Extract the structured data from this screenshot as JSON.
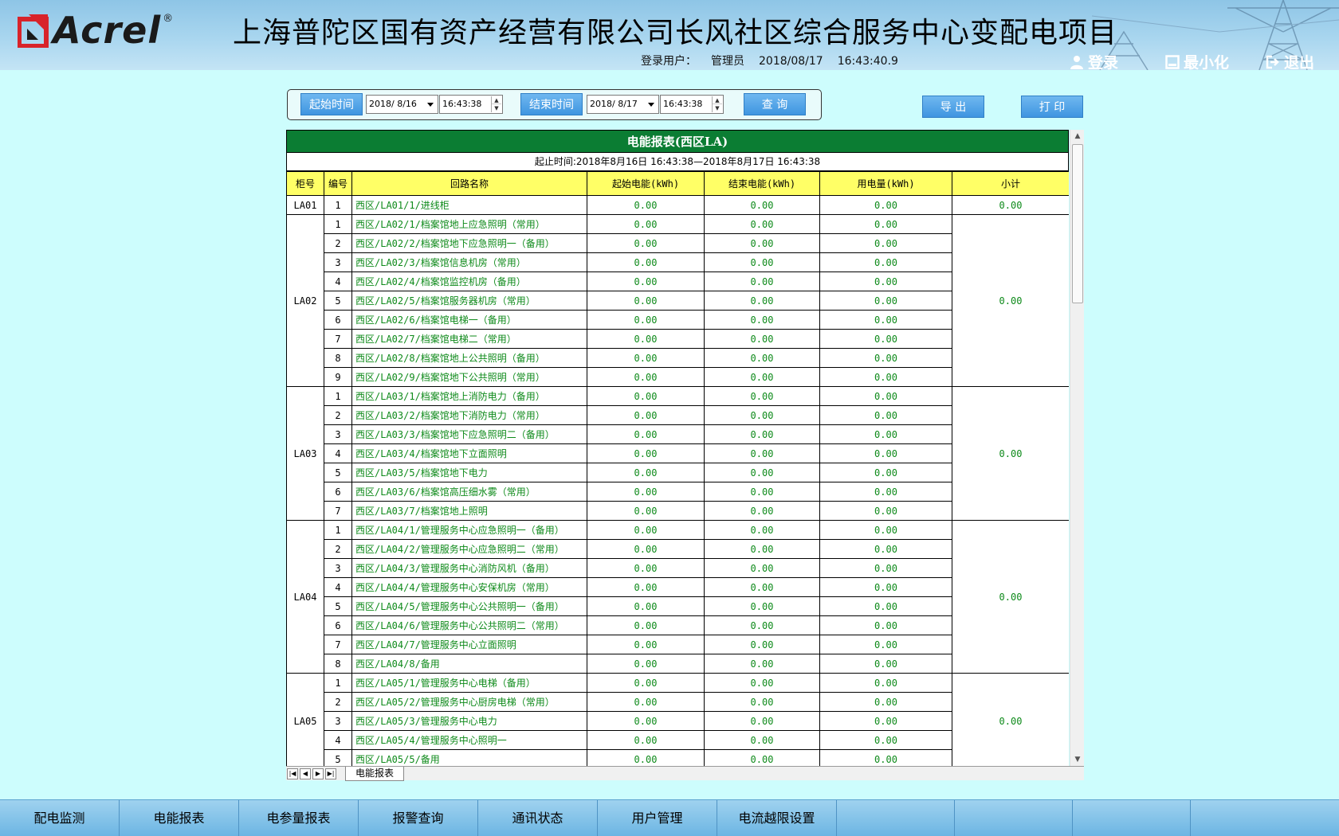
{
  "header": {
    "logo_text": "Acrel",
    "logo_reg": "®",
    "title": "上海普陀区国有资产经营有限公司长风社区综合服务中心变配电项目",
    "login_label": "登录用户：",
    "user": "管理员",
    "date": "2018/08/17",
    "time": "16:43:40.9",
    "buttons": {
      "login": "登录",
      "minimize": "最小化",
      "exit": "退出"
    }
  },
  "query": {
    "start_label": "起始时间",
    "start_date": "2018/ 8/16",
    "start_time": "16:43:38",
    "end_label": "结束时间",
    "end_date": "2018/ 8/17",
    "end_time": "16:43:38",
    "query_button": "查 询",
    "export_button": "导 出",
    "print_button": "打 印"
  },
  "report": {
    "title": "电能报表(西区LA)",
    "time_range": "起止时间:2018年8月16日  16:43:38—2018年8月17日  16:43:38",
    "columns": [
      "柜号",
      "编号",
      "回路名称",
      "起始电能(kWh)",
      "结束电能(kWh)",
      "用电量(kWh)",
      "小计"
    ],
    "groups": [
      {
        "cabinet": "LA01",
        "subtotal": "0.00",
        "rows": [
          {
            "num": "1",
            "name": "西区/LA01/1/进线柜",
            "start": "0.00",
            "end": "0.00",
            "usage": "0.00"
          }
        ]
      },
      {
        "cabinet": "LA02",
        "subtotal": "0.00",
        "rows": [
          {
            "num": "1",
            "name": "西区/LA02/1/档案馆地上应急照明（常用）",
            "start": "0.00",
            "end": "0.00",
            "usage": "0.00"
          },
          {
            "num": "2",
            "name": "西区/LA02/2/档案馆地下应急照明一（备用）",
            "start": "0.00",
            "end": "0.00",
            "usage": "0.00"
          },
          {
            "num": "3",
            "name": "西区/LA02/3/档案馆信息机房（常用）",
            "start": "0.00",
            "end": "0.00",
            "usage": "0.00"
          },
          {
            "num": "4",
            "name": "西区/LA02/4/档案馆监控机房（备用）",
            "start": "0.00",
            "end": "0.00",
            "usage": "0.00"
          },
          {
            "num": "5",
            "name": "西区/LA02/5/档案馆服务器机房（常用）",
            "start": "0.00",
            "end": "0.00",
            "usage": "0.00"
          },
          {
            "num": "6",
            "name": "西区/LA02/6/档案馆电梯一（备用）",
            "start": "0.00",
            "end": "0.00",
            "usage": "0.00"
          },
          {
            "num": "7",
            "name": "西区/LA02/7/档案馆电梯二（常用）",
            "start": "0.00",
            "end": "0.00",
            "usage": "0.00"
          },
          {
            "num": "8",
            "name": "西区/LA02/8/档案馆地上公共照明（备用）",
            "start": "0.00",
            "end": "0.00",
            "usage": "0.00"
          },
          {
            "num": "9",
            "name": "西区/LA02/9/档案馆地下公共照明（常用）",
            "start": "0.00",
            "end": "0.00",
            "usage": "0.00"
          }
        ]
      },
      {
        "cabinet": "LA03",
        "subtotal": "0.00",
        "rows": [
          {
            "num": "1",
            "name": "西区/LA03/1/档案馆地上消防电力（备用）",
            "start": "0.00",
            "end": "0.00",
            "usage": "0.00"
          },
          {
            "num": "2",
            "name": "西区/LA03/2/档案馆地下消防电力（常用）",
            "start": "0.00",
            "end": "0.00",
            "usage": "0.00"
          },
          {
            "num": "3",
            "name": "西区/LA03/3/档案馆地下应急照明二（备用）",
            "start": "0.00",
            "end": "0.00",
            "usage": "0.00"
          },
          {
            "num": "4",
            "name": "西区/LA03/4/档案馆地下立面照明",
            "start": "0.00",
            "end": "0.00",
            "usage": "0.00"
          },
          {
            "num": "5",
            "name": "西区/LA03/5/档案馆地下电力",
            "start": "0.00",
            "end": "0.00",
            "usage": "0.00"
          },
          {
            "num": "6",
            "name": "西区/LA03/6/档案馆高压细水雾（常用）",
            "start": "0.00",
            "end": "0.00",
            "usage": "0.00"
          },
          {
            "num": "7",
            "name": "西区/LA03/7/档案馆地上照明",
            "start": "0.00",
            "end": "0.00",
            "usage": "0.00"
          }
        ]
      },
      {
        "cabinet": "LA04",
        "subtotal": "0.00",
        "rows": [
          {
            "num": "1",
            "name": "西区/LA04/1/管理服务中心应急照明一（备用）",
            "start": "0.00",
            "end": "0.00",
            "usage": "0.00"
          },
          {
            "num": "2",
            "name": "西区/LA04/2/管理服务中心应急照明二（常用）",
            "start": "0.00",
            "end": "0.00",
            "usage": "0.00"
          },
          {
            "num": "3",
            "name": "西区/LA04/3/管理服务中心消防风机（备用）",
            "start": "0.00",
            "end": "0.00",
            "usage": "0.00"
          },
          {
            "num": "4",
            "name": "西区/LA04/4/管理服务中心安保机房（常用）",
            "start": "0.00",
            "end": "0.00",
            "usage": "0.00"
          },
          {
            "num": "5",
            "name": "西区/LA04/5/管理服务中心公共照明一（备用）",
            "start": "0.00",
            "end": "0.00",
            "usage": "0.00"
          },
          {
            "num": "6",
            "name": "西区/LA04/6/管理服务中心公共照明二（常用）",
            "start": "0.00",
            "end": "0.00",
            "usage": "0.00"
          },
          {
            "num": "7",
            "name": "西区/LA04/7/管理服务中心立面照明",
            "start": "0.00",
            "end": "0.00",
            "usage": "0.00"
          },
          {
            "num": "8",
            "name": "西区/LA04/8/备用",
            "start": "0.00",
            "end": "0.00",
            "usage": "0.00"
          }
        ]
      },
      {
        "cabinet": "LA05",
        "subtotal": "0.00",
        "rows": [
          {
            "num": "1",
            "name": "西区/LA05/1/管理服务中心电梯（备用）",
            "start": "0.00",
            "end": "0.00",
            "usage": "0.00"
          },
          {
            "num": "2",
            "name": "西区/LA05/2/管理服务中心厨房电梯（常用）",
            "start": "0.00",
            "end": "0.00",
            "usage": "0.00"
          },
          {
            "num": "3",
            "name": "西区/LA05/3/管理服务中心电力",
            "start": "0.00",
            "end": "0.00",
            "usage": "0.00"
          },
          {
            "num": "4",
            "name": "西区/LA05/4/管理服务中心照明一",
            "start": "0.00",
            "end": "0.00",
            "usage": "0.00"
          },
          {
            "num": "5",
            "name": "西区/LA05/5/备用",
            "start": "0.00",
            "end": "0.00",
            "usage": "0.00"
          }
        ]
      }
    ]
  },
  "sheet_tab": "电能报表",
  "bottom_nav": [
    "配电监测",
    "电能报表",
    "电参量报表",
    "报警查询",
    "通讯状态",
    "用户管理",
    "电流越限设置"
  ],
  "colors": {
    "background": "#cdfdfd",
    "report_title_bg": "#0b7d33",
    "header_row_bg": "#ffff66",
    "value_text": "#0e8a1a",
    "button_blue": "#3f95e0",
    "logo_red": "#d8232a"
  },
  "icons": {
    "login": "user-icon",
    "minimize": "minimize-icon",
    "exit": "exit-icon"
  }
}
